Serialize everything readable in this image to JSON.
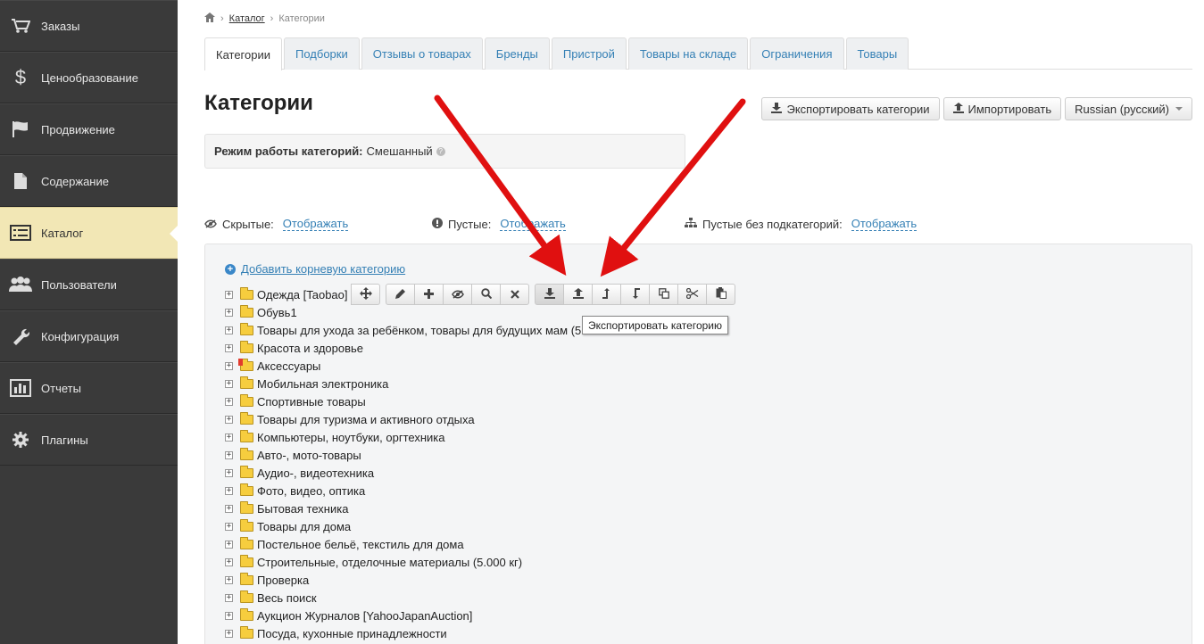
{
  "sidebar": {
    "items": [
      {
        "label": "Заказы",
        "icon": "cart-icon"
      },
      {
        "label": "Ценообразование",
        "icon": "dollar-icon"
      },
      {
        "label": "Продвижение",
        "icon": "flag-icon"
      },
      {
        "label": "Содержание",
        "icon": "document-icon"
      },
      {
        "label": "Каталог",
        "icon": "list-icon",
        "active": true
      },
      {
        "label": "Пользователи",
        "icon": "users-icon"
      },
      {
        "label": "Конфигурация",
        "icon": "wrench-icon"
      },
      {
        "label": "Отчеты",
        "icon": "bar-chart-icon"
      },
      {
        "label": "Плагины",
        "icon": "gear-icon"
      }
    ]
  },
  "breadcrumb": {
    "home_icon": "home-icon",
    "link": "Каталог",
    "current": "Категории",
    "separator": "›"
  },
  "tabs": [
    "Категории",
    "Подборки",
    "Отзывы о товарах",
    "Бренды",
    "Пристрой",
    "Товары на складе",
    "Ограничения",
    "Товары"
  ],
  "page": {
    "title": "Категории",
    "export_button": "Экспортировать категории",
    "import_button": "Импортировать",
    "language_select": "Russian (русский)",
    "mode_label": "Режим работы категорий:",
    "mode_value": "Смешанный",
    "help_glyph": "?"
  },
  "filters": {
    "hidden_label": "Скрытые:",
    "hidden_value": "Отображать",
    "empty_label": "Пустые:",
    "empty_value": "Отображать",
    "empty_nosub_label": "Пустые без подкатегорий:",
    "empty_nosub_value": "Отображать"
  },
  "tree": {
    "add_root": "Добавить корневую категорию",
    "expander_glyph": "+",
    "nodes": [
      "Одежда [Taobao]",
      "Обувь1",
      "Товары для ухода за ребёнком, товары для будущих мам (5",
      "Красота и здоровье",
      "Аксессуары",
      "Мобильная электроника",
      "Спортивные товары",
      "Товары для туризма и активного отдыха",
      "Компьютеры, ноутбуки, оргтехника",
      "Авто-, мото-товары",
      "Аудио-, видеотехника",
      "Фото, видео, оптика",
      "Бытовая техника",
      "Товары для дома",
      "Постельное бельё, текстиль для дома",
      "Строительные, отделочные материалы (5.000 кг)",
      "Проверка",
      "Весь поиск",
      "Аукцион Журналов [YahooJapanAuction]",
      "Посуда, кухонные принадлежности"
    ]
  },
  "tooltip": "Экспортировать категорию",
  "colors": {
    "sidebar_bg": "#3a3a3a",
    "active_item_bg": "#f2e7b5",
    "link": "#3580b5",
    "arrow": "#e01010"
  }
}
